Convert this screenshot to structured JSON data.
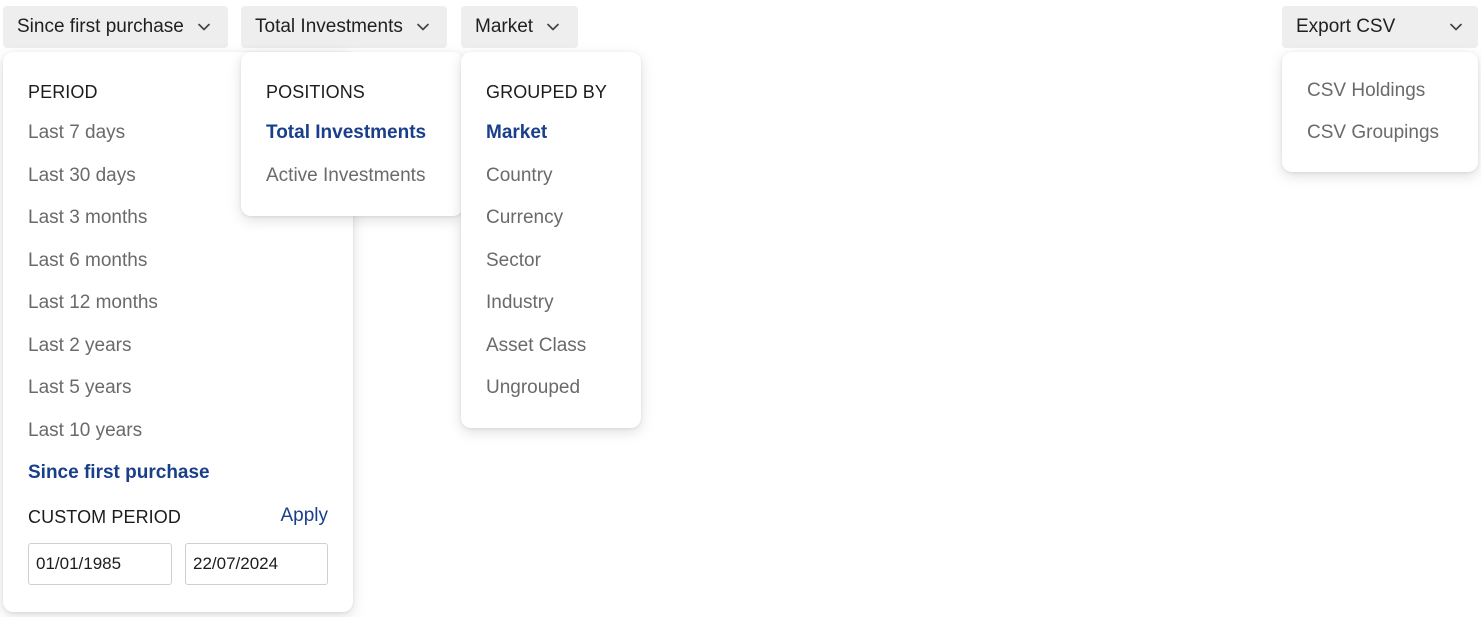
{
  "triggers": {
    "period": "Since first purchase",
    "positions": "Total Investments",
    "grouping": "Market",
    "export": "Export CSV"
  },
  "period_menu": {
    "heading": "PERIOD",
    "options": [
      "Last 7 days",
      "Last 30 days",
      "Last 3 months",
      "Last 6 months",
      "Last 12 months",
      "Last 2 years",
      "Last 5 years",
      "Last 10 years",
      "Since first purchase"
    ],
    "selected": "Since first purchase",
    "custom_heading": "CUSTOM PERIOD",
    "apply_label": "Apply",
    "start_date": "01/01/1985",
    "end_date": "22/07/2024"
  },
  "positions_menu": {
    "heading": "POSITIONS",
    "options": [
      "Total Investments",
      "Active Investments"
    ],
    "selected": "Total Investments"
  },
  "grouping_menu": {
    "heading": "GROUPED BY",
    "options": [
      "Market",
      "Country",
      "Currency",
      "Sector",
      "Industry",
      "Asset Class",
      "Ungrouped"
    ],
    "selected": "Market"
  },
  "export_menu": {
    "options": [
      "CSV Holdings",
      "CSV Groupings"
    ]
  },
  "icons": {
    "dropdown": "chevron-down-icon"
  },
  "colors": {
    "selected_text": "#1a3f8a",
    "option_text": "#6a6a6a",
    "trigger_bg": "#eeeeee"
  }
}
